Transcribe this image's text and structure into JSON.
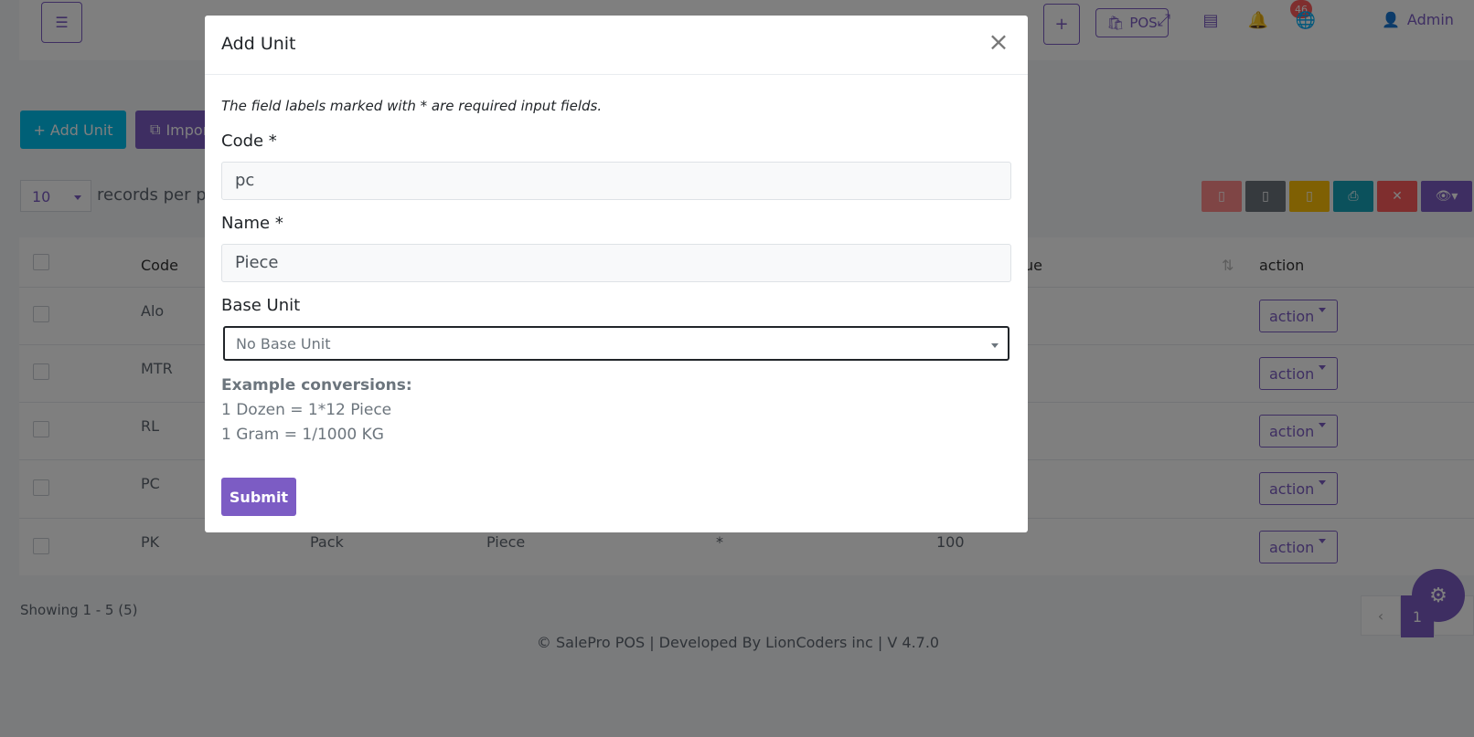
{
  "topbar": {
    "menu_icon": "menu-icon",
    "pos_label": "POS",
    "notification_count": "46",
    "user_label": "Admin"
  },
  "toolbar": {
    "add_unit_label": "+ Add Unit",
    "import_label": "Impor"
  },
  "table_controls": {
    "per_page_value": "10",
    "per_page_label": "records per pa"
  },
  "table": {
    "headers": {
      "code": "Code",
      "value": "ue",
      "action": "action"
    },
    "rows": [
      {
        "code": "Alo",
        "name": "",
        "base_unit": "",
        "operator": "",
        "value": "",
        "action": "action"
      },
      {
        "code": "MTR",
        "name": "",
        "base_unit": "",
        "operator": "",
        "value": "",
        "action": "action"
      },
      {
        "code": "RL",
        "name": "",
        "base_unit": "",
        "operator": "",
        "value": "",
        "action": "action"
      },
      {
        "code": "PC",
        "name": "",
        "base_unit": "",
        "operator": "",
        "value": "",
        "action": "action"
      },
      {
        "code": "PK",
        "name": "Pack",
        "base_unit": "Piece",
        "operator": "*",
        "value": "100",
        "action": "action"
      }
    ]
  },
  "pagination": {
    "showing": "Showing 1 - 5 (5)",
    "current_page": "1"
  },
  "footer": {
    "text": "© SalePro POS | Developed By LionCoders inc | V 4.7.0"
  },
  "modal": {
    "title": "Add Unit",
    "required_note": "The field labels marked with * are required input fields.",
    "code_label": "Code *",
    "code_value": "pc",
    "name_label": "Name *",
    "name_value": "Piece",
    "base_unit_label": "Base Unit",
    "base_unit_value": "No Base Unit",
    "example_title": "Example conversions:",
    "example_1": "1 Dozen = 1*12 Piece",
    "example_2": "1 Gram = 1/1000 KG",
    "submit_label": "Submit"
  },
  "colors": {
    "primary": "#7c5cc4",
    "info": "#00c0ef",
    "danger": "#ff5c5c"
  }
}
